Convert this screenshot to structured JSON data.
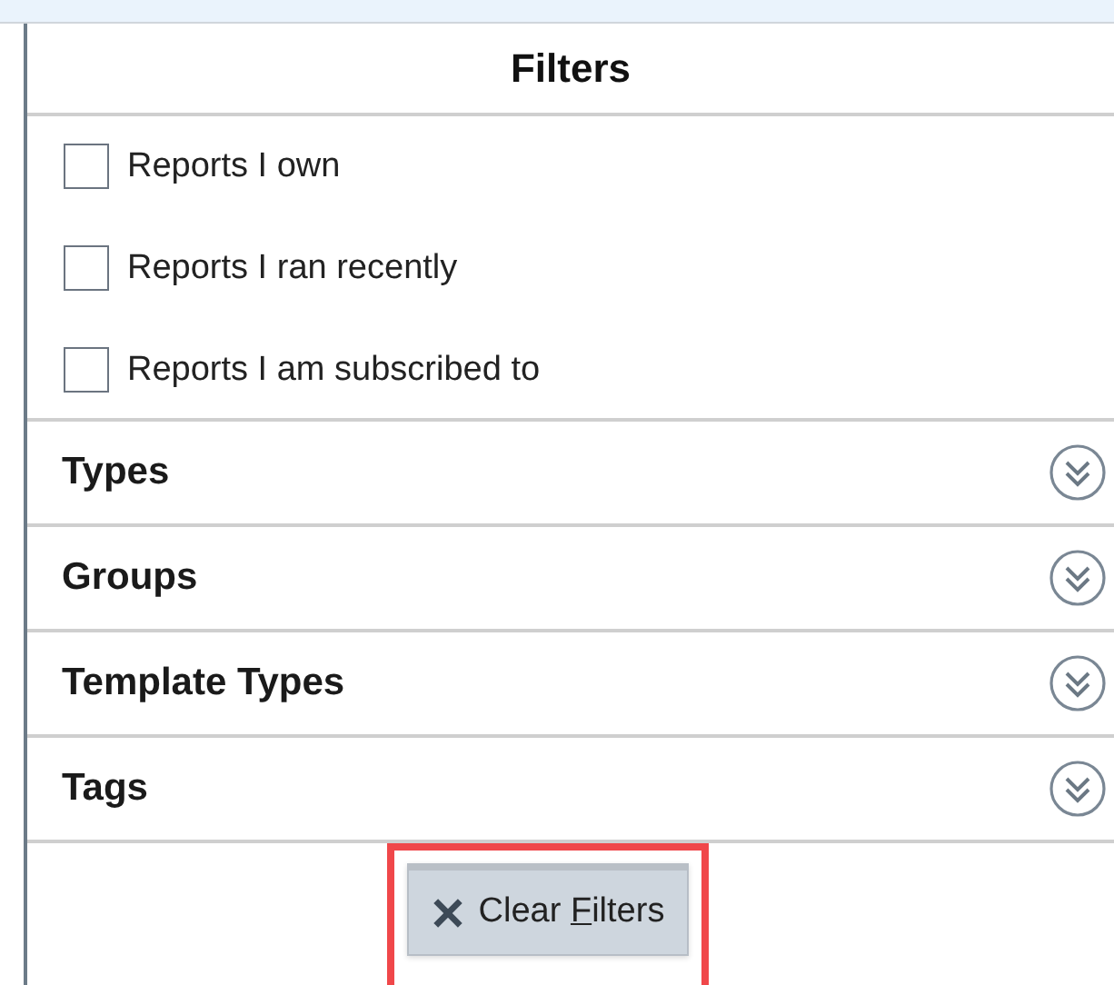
{
  "panel": {
    "title": "Filters"
  },
  "checkboxes": [
    {
      "label": "Reports I own",
      "checked": false
    },
    {
      "label": "Reports I ran recently",
      "checked": false
    },
    {
      "label": "Reports I am subscribed to",
      "checked": false
    }
  ],
  "sections": [
    {
      "label": "Types",
      "expanded": false
    },
    {
      "label": "Groups",
      "expanded": false
    },
    {
      "label": "Template Types",
      "expanded": false
    },
    {
      "label": "Tags",
      "expanded": false
    }
  ],
  "clear_button": {
    "label_parts": [
      "Clear ",
      "F",
      "ilters"
    ],
    "highlighted": true
  }
}
